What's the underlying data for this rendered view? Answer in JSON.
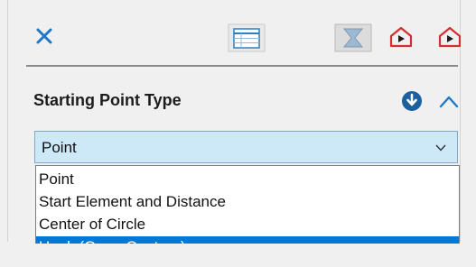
{
  "toolbar": {
    "icons": [
      "close-icon",
      "list-view-icon",
      "filter-icon",
      "route-start-icon",
      "route-end-icon"
    ],
    "accent_color": "#1e78c8",
    "route_icon_color": "#d0302f"
  },
  "section": {
    "title": "Starting Point Type",
    "info_icon": "info-down-icon",
    "collapse_icon": "chevron-up-icon"
  },
  "combo": {
    "value": "Point",
    "arrow_icon": "chevron-down-icon",
    "background": "#cde8f7"
  },
  "dropdown": {
    "options": [
      "Point",
      "Start Element and Distance",
      "Center of Circle",
      "Hook (Open Contour)"
    ],
    "highlighted": "Hook (Open Contour)",
    "highlight_color": "#0078d7"
  }
}
